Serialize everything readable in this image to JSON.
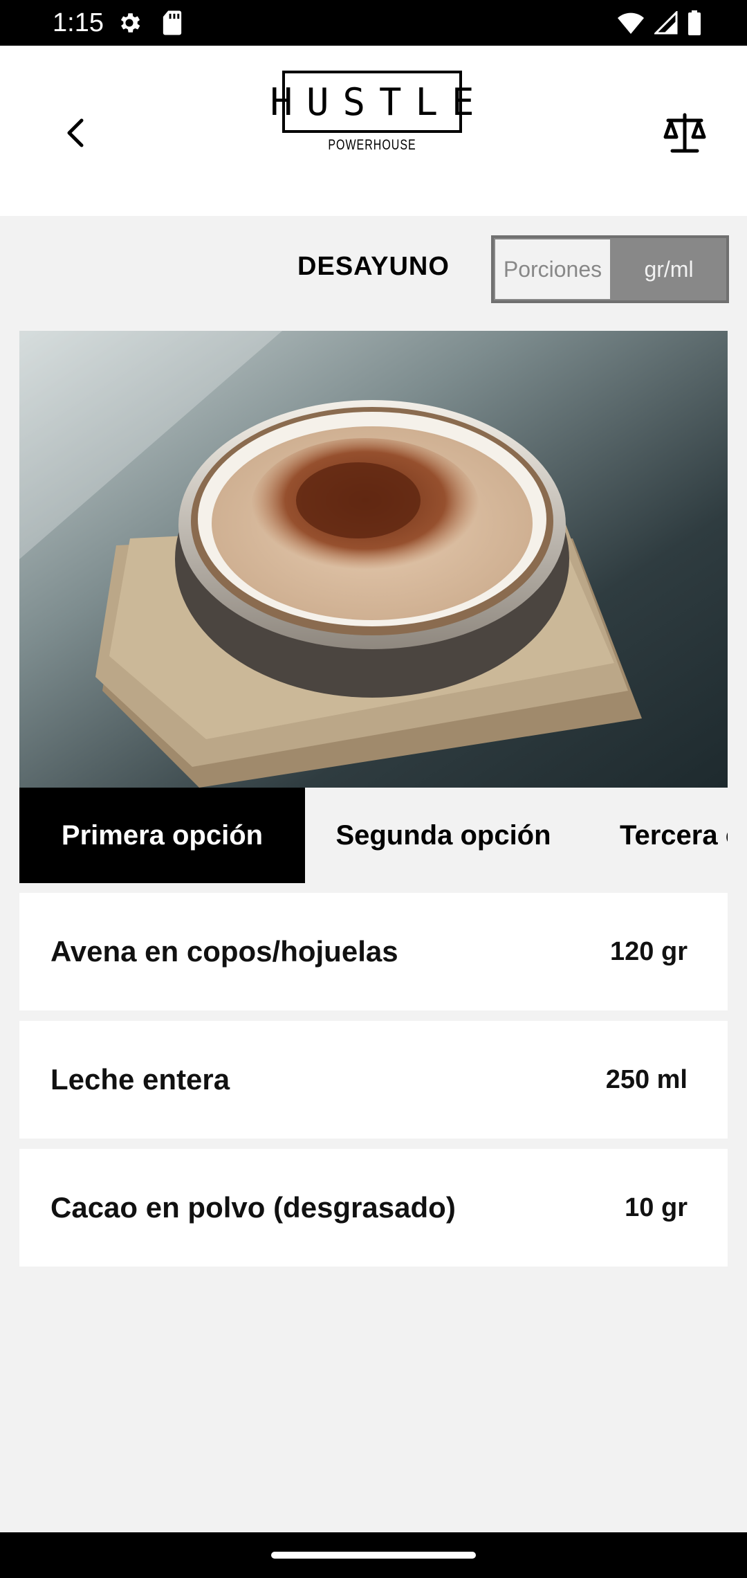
{
  "status_bar": {
    "time": "1:15"
  },
  "header": {
    "logo_title": "HUSTLE",
    "logo_subtitle": "POWERHOUSE"
  },
  "meal": {
    "title": "DESAYUNO",
    "unit_toggle": {
      "options": [
        "Porciones",
        "gr/ml"
      ],
      "selected": "gr/ml"
    }
  },
  "tabs": [
    {
      "label": "Primera opción",
      "active": true
    },
    {
      "label": "Segunda opción",
      "active": false
    },
    {
      "label": "Tercera opción",
      "active": false
    }
  ],
  "ingredients": [
    {
      "name": "Avena en copos/hojuelas",
      "quantity": "120 gr"
    },
    {
      "name": "Leche entera",
      "quantity": "250 ml"
    },
    {
      "name": "Cacao en polvo (desgrasado)",
      "quantity": "10 gr"
    }
  ],
  "colors": {
    "active_tab_bg": "#000000",
    "toggle_selected_bg": "#888888",
    "page_bg": "#f2f2f2"
  }
}
